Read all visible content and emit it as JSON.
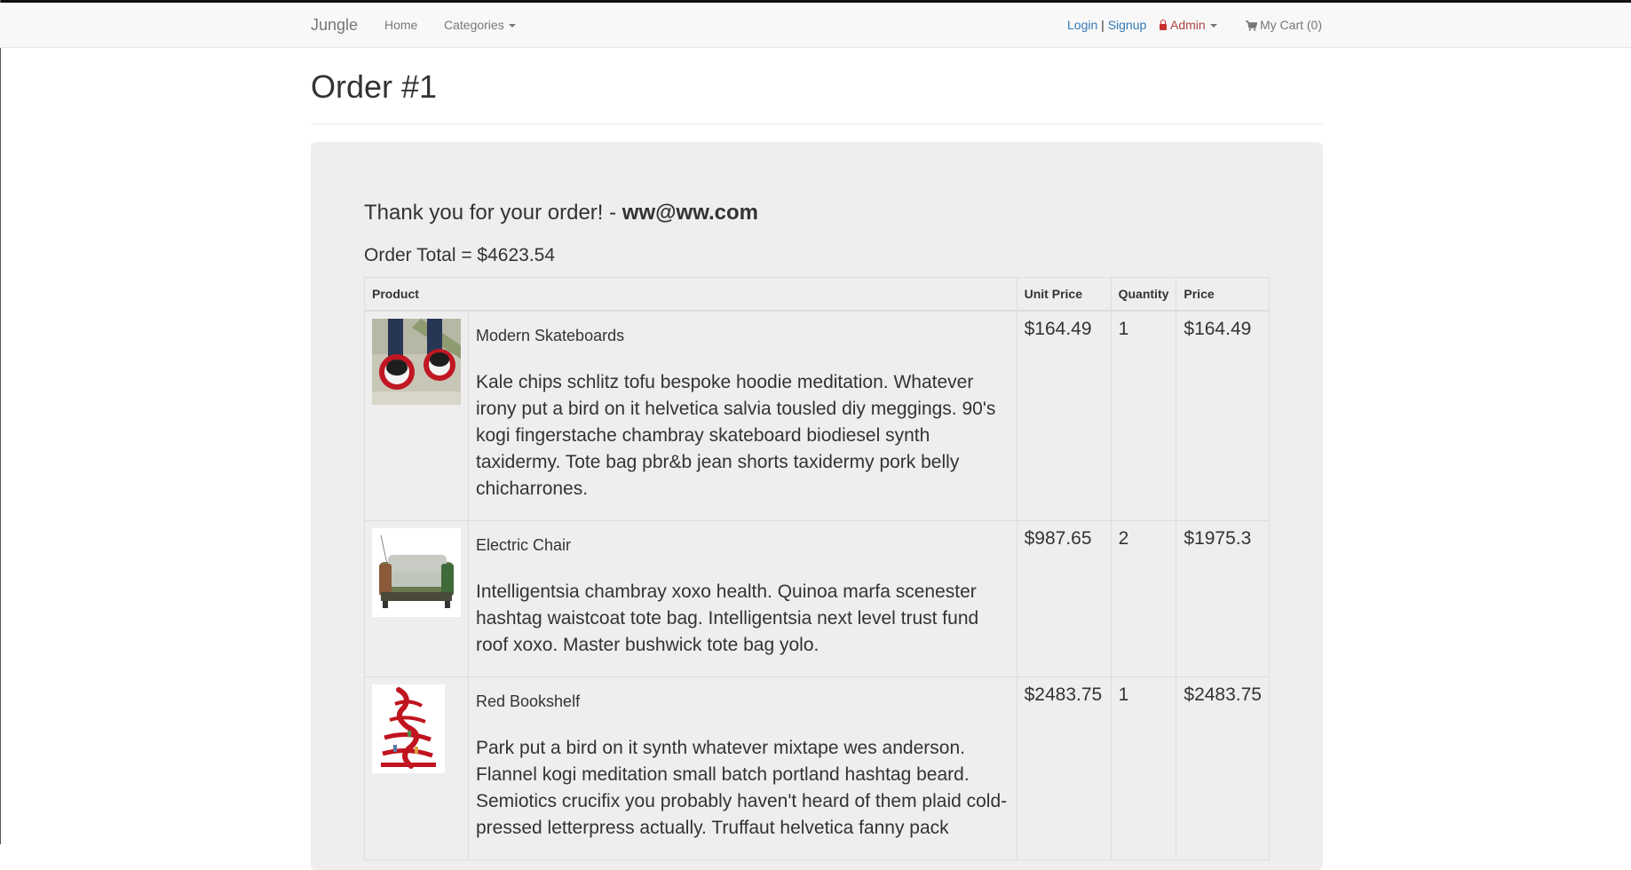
{
  "navbar": {
    "brand": "Jungle",
    "home": "Home",
    "categories": "Categories",
    "login": "Login",
    "separator": "|",
    "signup": "Signup",
    "admin": "Admin",
    "cart": "My Cart (0)"
  },
  "page": {
    "title": "Order #1"
  },
  "order": {
    "thanks_text": "Thank you for your order! - ",
    "email": "ww@ww.com",
    "total_text": "Order Total = $4623.54",
    "columns": {
      "product": "Product",
      "unit_price": "Unit Price",
      "quantity": "Quantity",
      "price": "Price"
    },
    "items": [
      {
        "name": "Modern Skateboards",
        "description": "Kale chips schlitz tofu bespoke hoodie meditation. Whatever irony put a bird on it helvetica salvia tousled diy meggings. 90's kogi fingerstache chambray skateboard biodiesel synth taxidermy. Tote bag pbr&b jean shorts taxidermy pork belly chicharrones.",
        "unit_price": "$164.49",
        "quantity": "1",
        "price": "$164.49"
      },
      {
        "name": "Electric Chair",
        "description": "Intelligentsia chambray xoxo health. Quinoa marfa scenester hashtag waistcoat tote bag. Intelligentsia next level trust fund roof xoxo. Master bushwick tote bag yolo.",
        "unit_price": "$987.65",
        "quantity": "2",
        "price": "$1975.3"
      },
      {
        "name": "Red Bookshelf",
        "description": "Park put a bird on it synth whatever mixtape wes anderson. Flannel kogi meditation small batch portland hashtag beard. Semiotics crucifix you probably haven't heard of them plaid cold-pressed letterpress actually. Truffaut helvetica fanny pack",
        "unit_price": "$2483.75",
        "quantity": "1",
        "price": "$2483.75"
      }
    ]
  },
  "colors": {
    "link": "#337ab7",
    "admin": "#a94442",
    "navbar_bg": "#f8f8f8",
    "jumbotron_bg": "#eeeeee"
  },
  "icons": [
    "caret-down-icon",
    "lock-icon",
    "shopping-cart-icon"
  ]
}
